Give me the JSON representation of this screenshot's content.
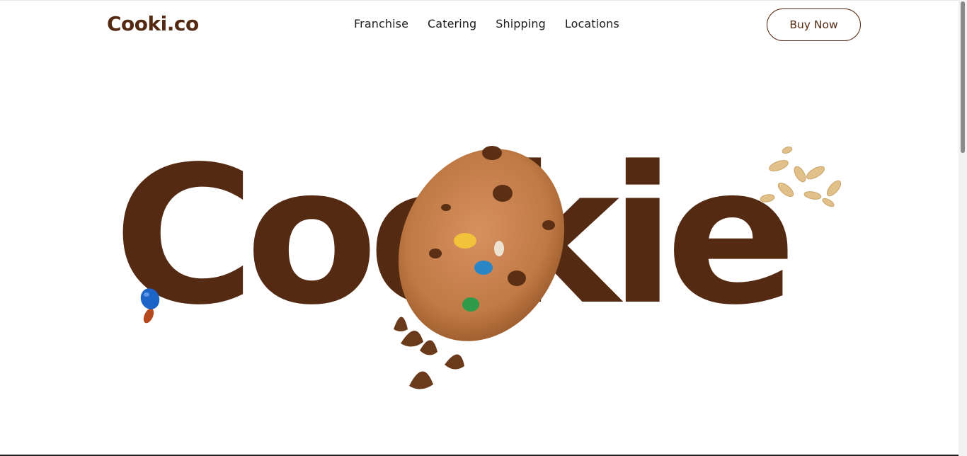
{
  "header": {
    "logo": "Cooki.co",
    "nav": [
      "Franchise",
      "Catering",
      "Shipping",
      "Locations"
    ],
    "buy_label": "Buy Now"
  },
  "hero": {
    "word": "Cookie"
  },
  "colors": {
    "brand_brown": "#552a13",
    "cookie": "#c07a45",
    "chocolate": "#5b2f14",
    "peanut": "#e2c08a",
    "candy_blue": "#1d64c9"
  },
  "icons": [
    "cookie-image",
    "chocolate-chip-image",
    "peanut-image",
    "candy-image"
  ]
}
